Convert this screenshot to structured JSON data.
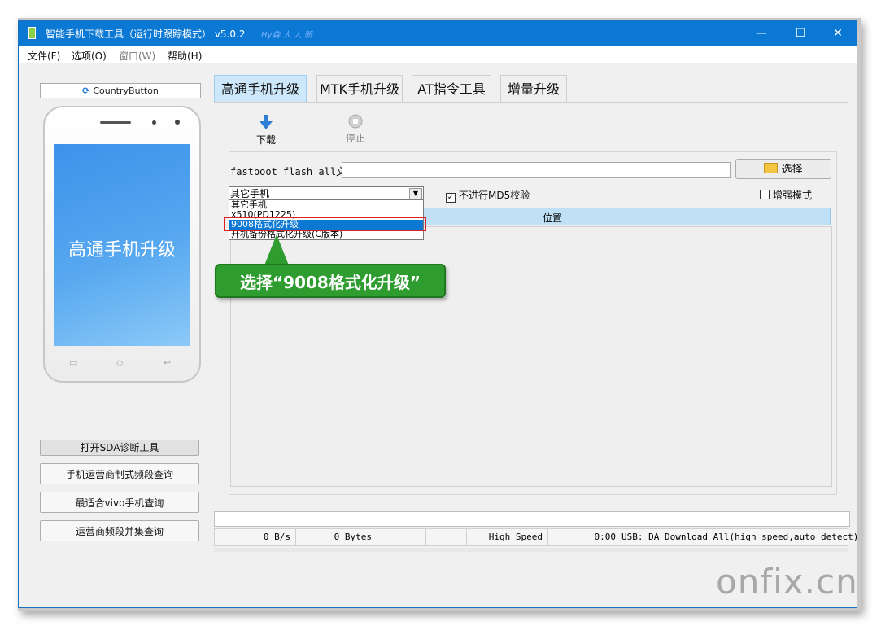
{
  "window": {
    "title": "智能手机下载工具（运行时跟踪模式）  v5.0.2",
    "watermark": "Hy森 人 人 新",
    "minimize": "—",
    "maximize": "☐",
    "close": "✕"
  },
  "menu": [
    "文件(F)",
    "选项(O)",
    "窗口(W)",
    "帮助(H)"
  ],
  "left": {
    "country_button": "CountryButton",
    "phone_screen_text": "高通手机升级",
    "buttons": [
      "打开SDA诊断工具",
      "手机运营商制式频段查询",
      "最适合vivo手机查询",
      "运营商频段并集查询"
    ]
  },
  "tabs": [
    "高通手机升级",
    "MTK手机升级",
    "AT指令工具",
    "增量升级"
  ],
  "toolbar": {
    "download": "下载",
    "stop": "停止"
  },
  "form": {
    "fastboot_label": "fastboot_flash_all文件",
    "fastboot_value": "",
    "select_button": "选择",
    "combo_value": "其它手机",
    "no_md5": "不进行MD5校验",
    "no_md5_checked": true,
    "enhanced": "增强模式",
    "enhanced_checked": false,
    "list_header": "位置"
  },
  "dropdown": {
    "options": [
      "其它手机",
      "x510(PD1225)",
      "9008格式化升级",
      "开机备份格式化升级(C版本)"
    ],
    "selected_index": 2
  },
  "callout": "选择“9008格式化升级”",
  "status": {
    "speed": "0 B/s",
    "bytes": "0 Bytes",
    "mode": "High Speed",
    "time": "0:00",
    "usb": "USB: DA Download All(high speed,auto detect)"
  },
  "brand": "onfix.cn",
  "colors": {
    "titlebar": "#0b78d4",
    "tab_active": "#cde8fb",
    "callout": "#2e9c2e",
    "highlight_box": "#e02020"
  }
}
